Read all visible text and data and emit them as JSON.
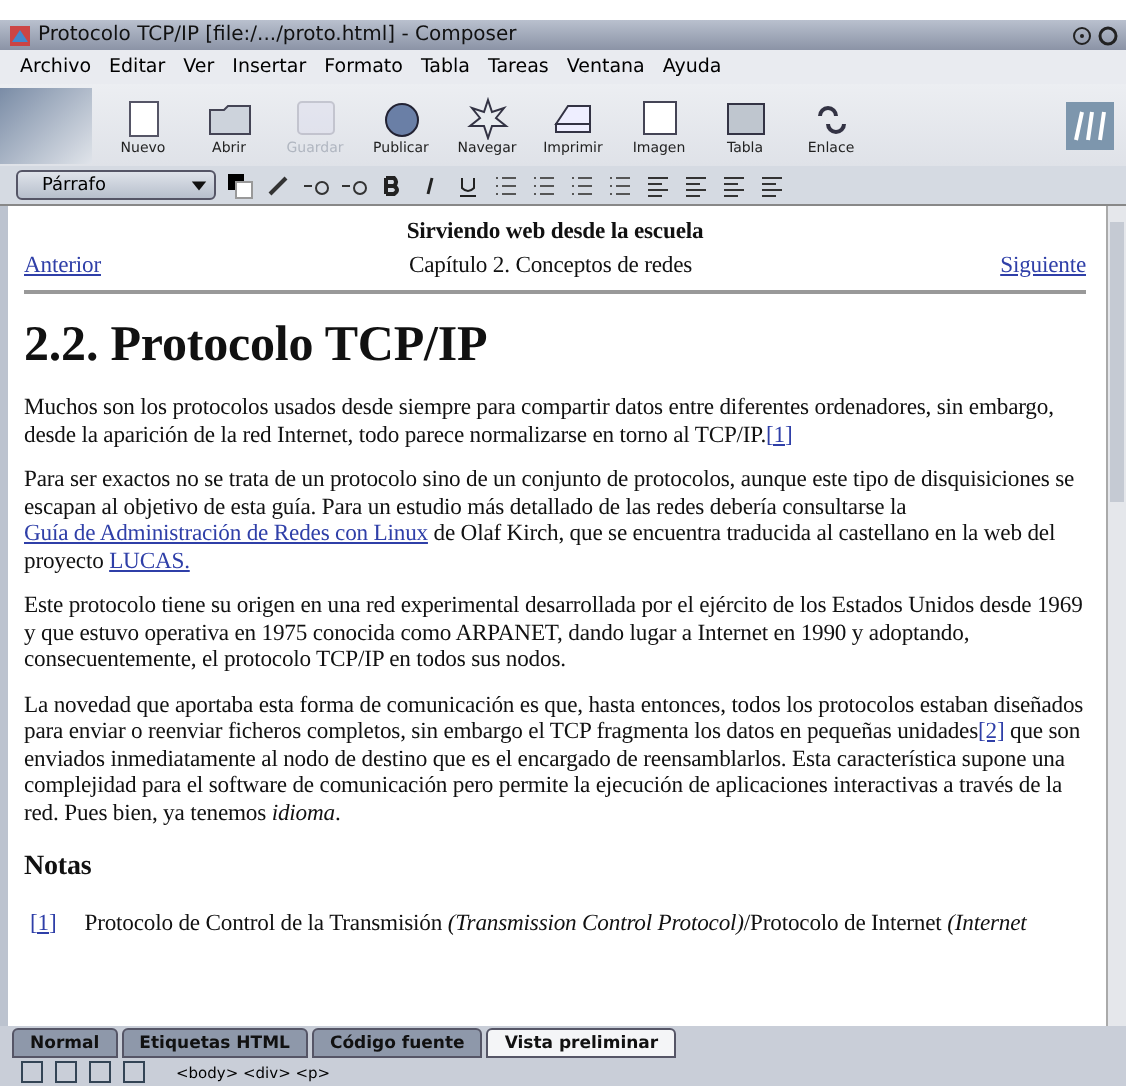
{
  "window": {
    "title": "Protocolo TCP/IP [file:/.../proto.html] - Composer"
  },
  "menu": [
    "Archivo",
    "Editar",
    "Ver",
    "Insertar",
    "Formato",
    "Tabla",
    "Tareas",
    "Ventana",
    "Ayuda"
  ],
  "toolbar": [
    {
      "label": "Nuevo",
      "disabled": false
    },
    {
      "label": "Abrir",
      "disabled": false
    },
    {
      "label": "Guardar",
      "disabled": true
    },
    {
      "label": "Publicar",
      "disabled": false
    },
    {
      "label": "Navegar",
      "disabled": false
    },
    {
      "label": "Imprimir",
      "disabled": false
    },
    {
      "label": "Imagen",
      "disabled": false
    },
    {
      "label": "Tabla",
      "disabled": false
    },
    {
      "label": "Enlace",
      "disabled": false
    }
  ],
  "format_bar": {
    "paragraph_style": "Párrafo"
  },
  "document": {
    "header": "Sirviendo web desde la escuela",
    "prev_link": "Anterior",
    "chapter": "Capítulo 2. Conceptos de redes",
    "next_link": "Siguiente",
    "heading": "2.2. Protocolo TCP/IP",
    "paragraphs": [
      [
        {
          "kind": "text",
          "text": "Muchos son los protocolos usados desde siempre para compartir datos entre diferentes ordenadores, sin embargo, desde la aparición de la red Internet, todo parece normalizarse en torno al TCP/IP."
        },
        {
          "kind": "link",
          "text": "[1]"
        }
      ],
      [
        {
          "kind": "text",
          "text": "Para ser exactos no se trata de un protocolo sino de un conjunto de protocolos, aunque este tipo de disquisiciones se escapan al objetivo de esta guía. Para un estudio más detallado de las redes debería consultarse la "
        },
        {
          "kind": "link",
          "text": "Guía de Administración de Redes con Linux"
        },
        {
          "kind": "text",
          "text": " de Olaf Kirch, que se encuentra traducida al castellano en la web del proyecto "
        },
        {
          "kind": "link",
          "text": "LUCAS."
        }
      ],
      [
        {
          "kind": "text",
          "text": "Este protocolo tiene su origen en una red experimental desarrollada por el ejército de los Estados Unidos desde 1969 y que estuvo operativa en 1975 conocida como ARPANET, dando lugar a Internet en 1990 y adoptando, consecuentemente, el protocolo TCP/IP en todos sus nodos."
        }
      ],
      [
        {
          "kind": "text",
          "text": "La novedad que aportaba esta forma de comunicación es que, hasta entonces, todos los protocolos estaban diseñados para enviar o reenviar ficheros completos, sin embargo el TCP fragmenta los datos en pequeñas unidades"
        },
        {
          "kind": "link",
          "text": "[2]"
        },
        {
          "kind": "text",
          "text": " que son enviados inmediatamente al nodo de destino que es el encargado de reensamblarlos. Esta característica supone una complejidad para el software de comunicación pero permite la ejecución de aplicaciones interactivas a través de la red. Pues bien, ya tenemos *idioma*."
        }
      ]
    ],
    "notes_heading": "Notas",
    "notes": [
      {
        "ref": "[1]",
        "text": "Protocolo de Control de la Transmisión *(Transmission Control Protocol)*/Protocolo de Internet *(Internet*"
      }
    ]
  },
  "tabs": [
    {
      "label": "Normal",
      "selected": false
    },
    {
      "label": "Etiquetas HTML",
      "selected": false
    },
    {
      "label": "Código fuente",
      "selected": false
    },
    {
      "label": "Vista preliminar",
      "selected": true
    }
  ],
  "status_bar": {
    "path": "<body> <div> <p>"
  }
}
